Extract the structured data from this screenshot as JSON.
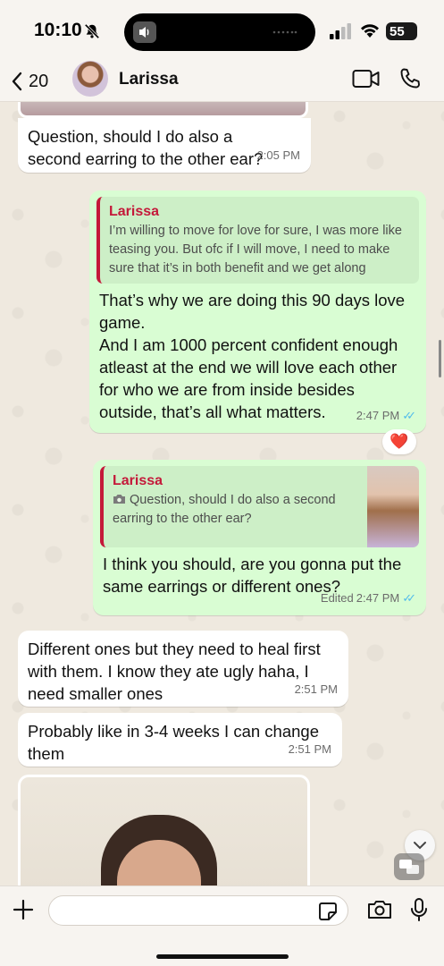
{
  "status_bar": {
    "time": "10:10",
    "battery": "55"
  },
  "header": {
    "back_count": "20",
    "contact_name": "Larissa"
  },
  "messages": [
    {
      "id": "m1",
      "direction": "incoming",
      "text": "Question, should I do also a second earring to the other ear?",
      "time": "2:05 PM"
    },
    {
      "id": "m2",
      "direction": "outgoing",
      "quote_name": "Larissa",
      "quote_text": "I’m willing to move for love for sure, I was more like teasing you. But ofc if I will move, I need to make sure that it’s in both benefit and we get along",
      "text": "That’s why we are doing this 90 days love game.\nAnd I am 1000 percent confident enough atleast at the end we will love each other for who we are from inside besides outside, that’s all what matters.",
      "time": "2:47 PM",
      "reaction": "❤️"
    },
    {
      "id": "m3",
      "direction": "outgoing",
      "quote_name": "Larissa",
      "quote_text": "Question, should I do also a second earring to the other ear?",
      "text": "I think you should, are you gonna put the same earrings or different ones?",
      "edited_label": "Edited",
      "time": "2:47 PM"
    },
    {
      "id": "m4",
      "direction": "incoming",
      "text": "Different ones but they need to heal first with them. I know they ate ugly haha, I need smaller ones",
      "time": "2:51 PM"
    },
    {
      "id": "m5",
      "direction": "incoming",
      "text": "Probably like in 3-4 weeks I can change them",
      "time": "2:51 PM"
    }
  ],
  "input": {
    "placeholder": ""
  },
  "colors": {
    "outgoing_bubble": "#d9fdd3",
    "incoming_bubble": "#ffffff",
    "quote_accent": "#c4193a",
    "read_ticks": "#53bdeb"
  },
  "icons": [
    "bell-slash-icon",
    "speaker-icon",
    "signal-icon",
    "wifi-icon",
    "battery-icon",
    "chevron-left-icon",
    "video-camera-icon",
    "phone-icon",
    "camera-icon",
    "heart-icon",
    "chevron-down-icon",
    "chat-bubbles-icon",
    "plus-icon",
    "sticker-icon",
    "microphone-icon"
  ]
}
